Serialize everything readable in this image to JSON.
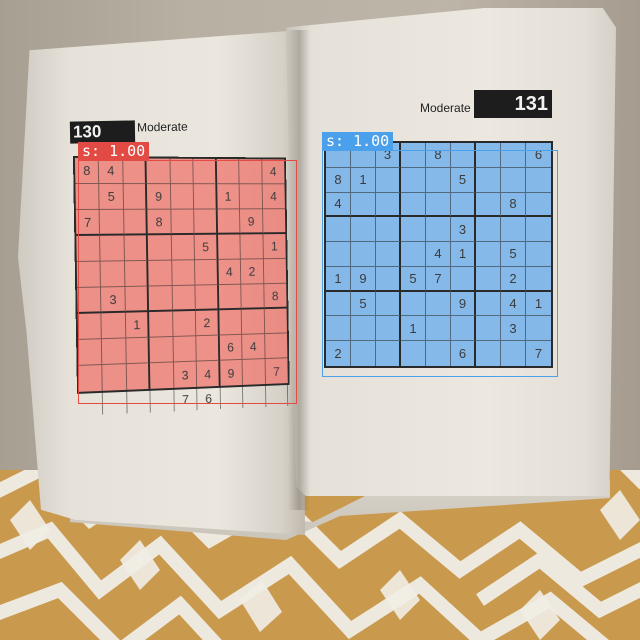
{
  "book": {
    "left_page": {
      "puzzle_number": "130",
      "difficulty": "Moderate"
    },
    "right_page": {
      "puzzle_number": "131",
      "difficulty": "Moderate"
    }
  },
  "detections": [
    {
      "label": "s: 1.00",
      "color": "#e24b43",
      "fill": "#ee7870"
    },
    {
      "label": "s: 1.00",
      "color": "#4aa0ea",
      "fill": "#6eafeb"
    }
  ],
  "colors": {
    "fabric": "#c99a4e",
    "fabric_pattern": "#f1eee6",
    "paper": "#ebe7df"
  },
  "grids": {
    "left": [
      [
        "8",
        "4",
        "",
        "",
        "",
        "",
        "",
        "",
        "4"
      ],
      [
        "",
        "5",
        "",
        "9",
        "",
        "",
        "1",
        "",
        "4"
      ],
      [
        "7",
        "",
        "",
        "8",
        "",
        "",
        "",
        "9",
        ""
      ],
      [
        "",
        "",
        "",
        "",
        "",
        "5",
        "",
        "",
        "1"
      ],
      [
        "",
        "",
        "",
        "",
        "",
        "",
        "4",
        "2",
        ""
      ],
      [
        "",
        "3",
        "",
        "",
        "",
        "",
        "",
        "",
        "8"
      ],
      [
        "",
        "",
        "1",
        "",
        "",
        "2",
        "",
        "",
        ""
      ],
      [
        "",
        "",
        "",
        "",
        "",
        "",
        "6",
        "4",
        ""
      ],
      [
        "",
        "",
        "",
        "",
        "3",
        "4",
        "9",
        "",
        "7"
      ]
    ],
    "left_extra_row": [
      "",
      "",
      "",
      "",
      "7",
      "6",
      "",
      "",
      ""
    ],
    "right": [
      [
        "",
        "",
        "3",
        "",
        "8",
        "",
        "",
        "",
        "6"
      ],
      [
        "8",
        "1",
        "",
        "",
        "",
        "5",
        "",
        "",
        ""
      ],
      [
        "4",
        "",
        "",
        "",
        "",
        "",
        "",
        "8",
        ""
      ],
      [
        "",
        "",
        "",
        "",
        "",
        "3",
        "",
        "",
        ""
      ],
      [
        "",
        "",
        "",
        "",
        "4",
        "1",
        "",
        "5",
        ""
      ],
      [
        "1",
        "9",
        "",
        "5",
        "7",
        "",
        "",
        "2",
        ""
      ],
      [
        "",
        "5",
        "",
        "",
        "",
        "9",
        "",
        "4",
        "1"
      ],
      [
        "",
        "",
        "",
        "1",
        "",
        "",
        "",
        "3",
        ""
      ],
      [
        "2",
        "",
        "",
        "",
        "",
        "6",
        "",
        "",
        "7"
      ]
    ]
  }
}
